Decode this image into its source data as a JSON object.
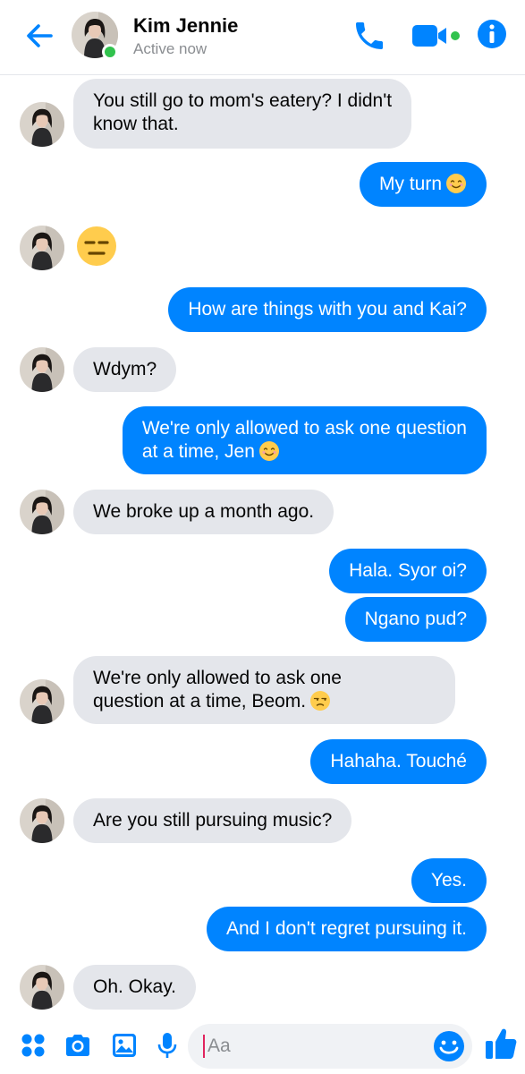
{
  "header": {
    "contact_name": "Kim Jennie",
    "status": "Active now",
    "accent_color": "#0084ff",
    "online_color": "#31c24d",
    "icons": [
      "back-arrow-icon",
      "phone-icon",
      "video-camera-icon",
      "info-icon"
    ]
  },
  "messages": [
    {
      "from": "contact",
      "lines": [
        "You still go to mom's eatery? I didn't",
        "know that."
      ]
    },
    {
      "from": "me",
      "text": "My turn",
      "emoji": "smiling-face"
    },
    {
      "from": "contact",
      "emoji_only": "expressionless-face"
    },
    {
      "from": "me",
      "text": "How are things with you and Kai?"
    },
    {
      "from": "contact",
      "text": "Wdym?"
    },
    {
      "from": "me",
      "lines": [
        "We're only allowed to ask one question",
        "at a time, Jen"
      ],
      "emoji": "smiling-face"
    },
    {
      "from": "contact",
      "text": "We broke up a month ago."
    },
    {
      "from": "me",
      "text": "Hala. Syor oi?"
    },
    {
      "from": "me",
      "text": "Ngano pud?"
    },
    {
      "from": "contact",
      "lines": [
        "We're only allowed to ask one",
        "question at a time, Beom."
      ],
      "emoji": "unamused-face"
    },
    {
      "from": "me",
      "text": "Hahaha. Touché"
    },
    {
      "from": "contact",
      "text": "Are you still pursuing music?"
    },
    {
      "from": "me",
      "text": "Yes."
    },
    {
      "from": "me",
      "text": "And I don't regret pursuing it."
    },
    {
      "from": "contact",
      "text": "Oh. Okay."
    }
  ],
  "composer": {
    "placeholder": "Aa",
    "icons": [
      "apps-grid-icon",
      "camera-icon",
      "gallery-icon",
      "microphone-icon",
      "emoji-icon",
      "thumbs-up-icon"
    ]
  }
}
